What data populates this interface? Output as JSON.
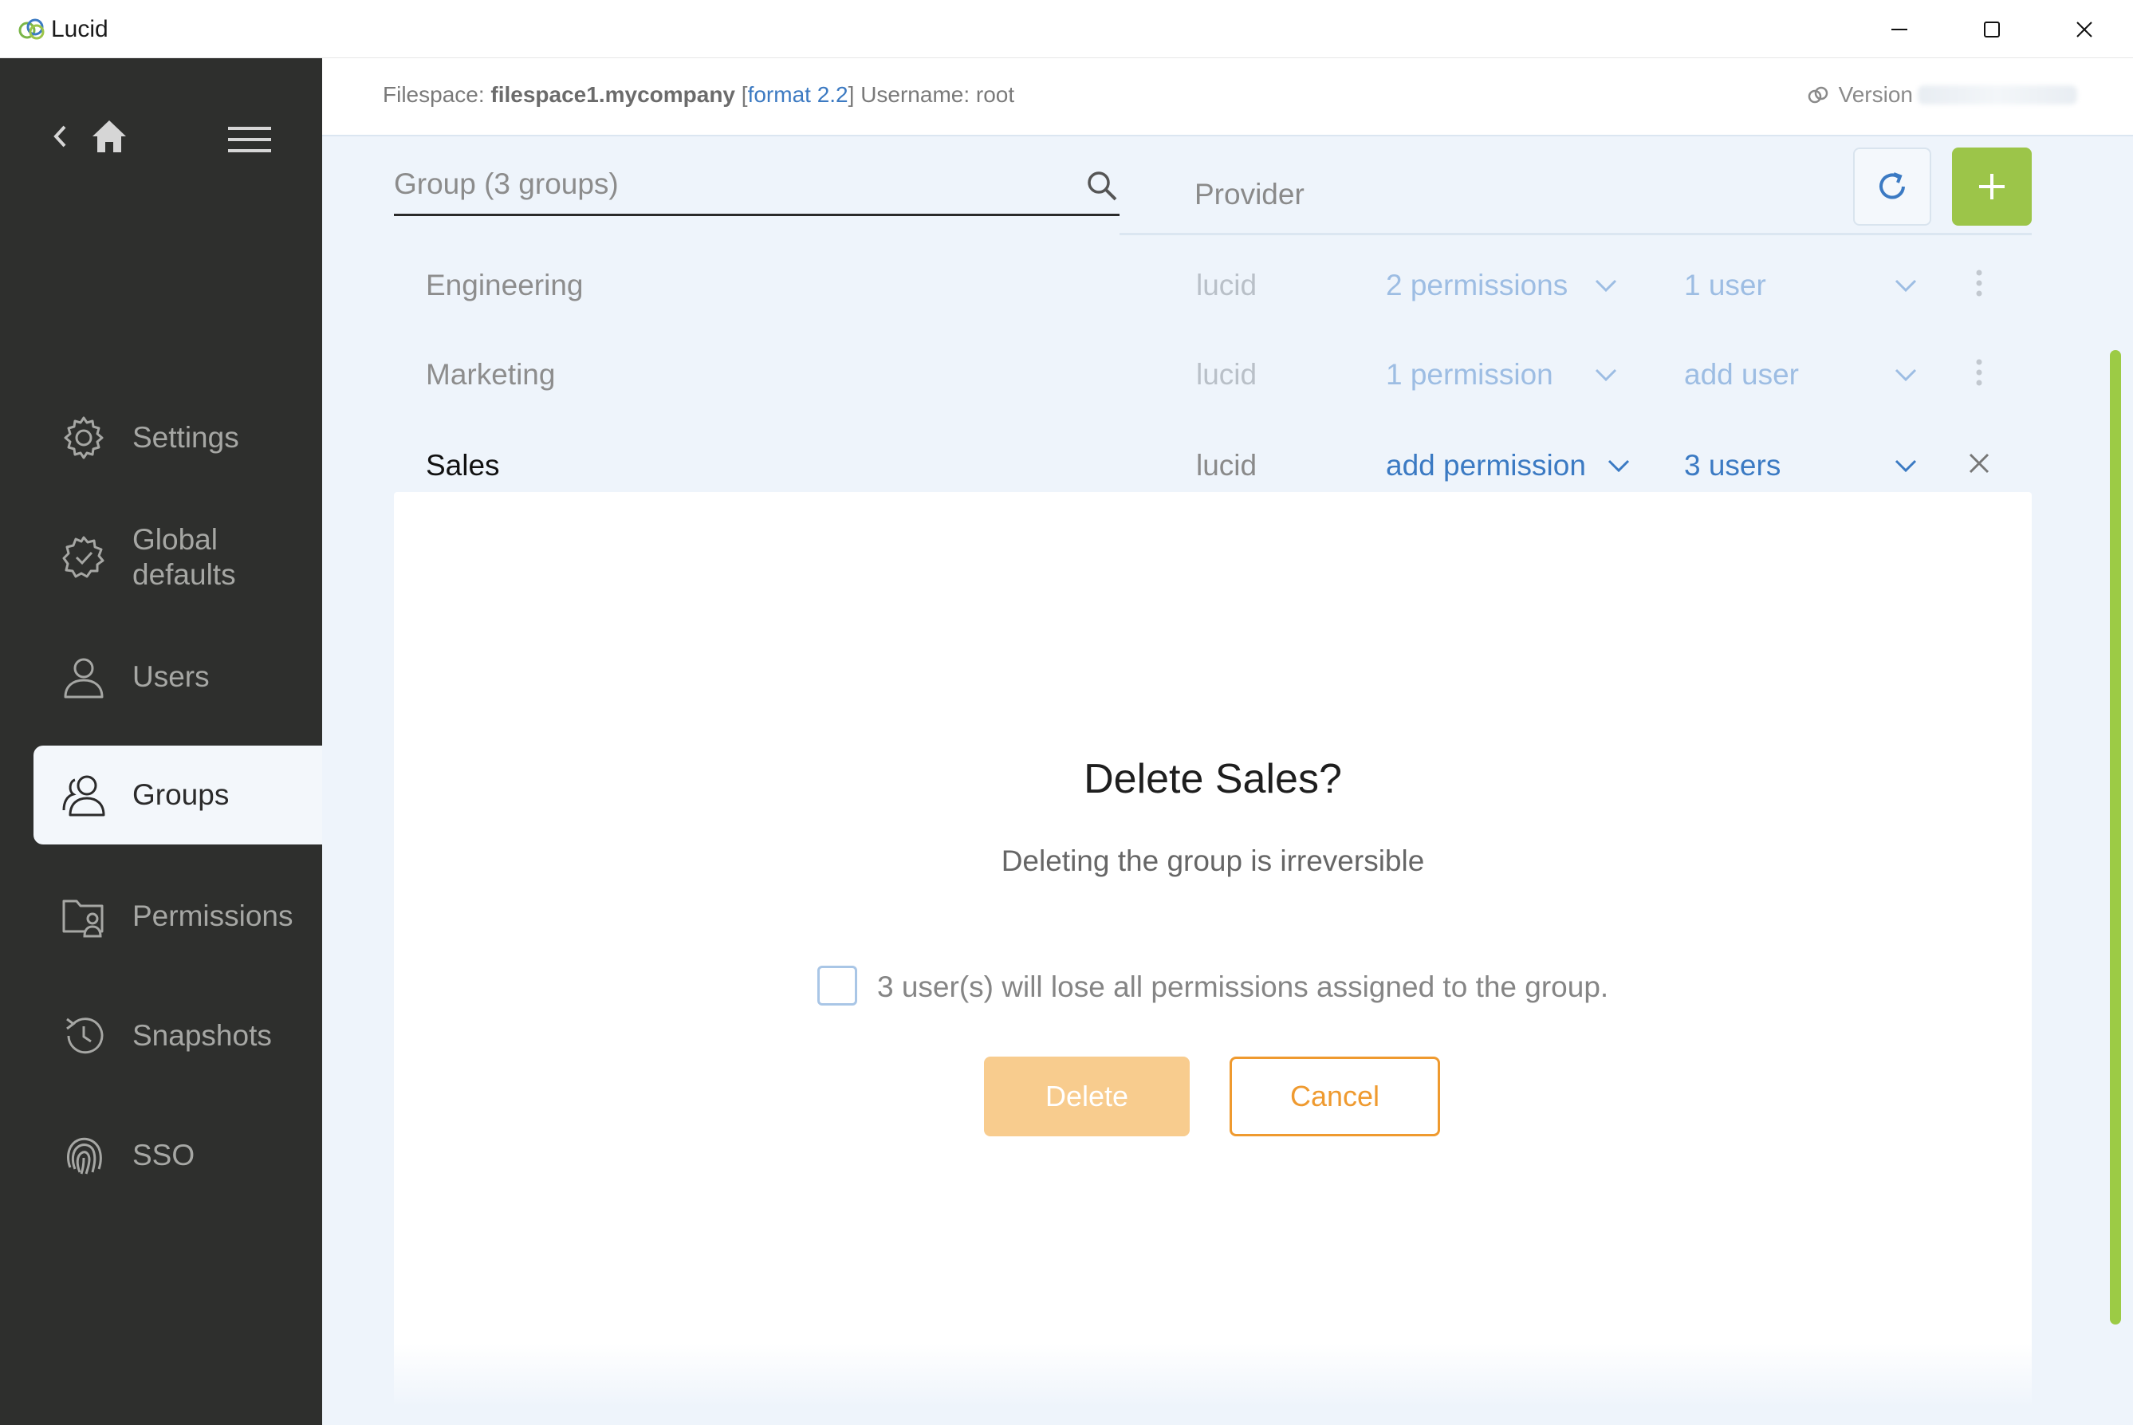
{
  "window": {
    "title": "Lucid",
    "minimize_icon": "minimize-icon",
    "maximize_icon": "maximize-icon",
    "close_icon": "close-icon"
  },
  "topbar": {
    "filespace_label": "Filespace:",
    "filespace_name": "filespace1.mycompany",
    "format_open": "[",
    "format_text": "format 2.2",
    "format_close": "]",
    "username": "Username: root",
    "version_label": "Version"
  },
  "sidebar": {
    "items": [
      {
        "label": "Settings",
        "icon": "gear-icon"
      },
      {
        "label": "Global defaults",
        "icon": "badge-check-icon"
      },
      {
        "label": "Users",
        "icon": "user-icon"
      },
      {
        "label": "Groups",
        "icon": "users-icon",
        "active": true
      },
      {
        "label": "Permissions",
        "icon": "folder-user-icon"
      },
      {
        "label": "Snapshots",
        "icon": "history-icon"
      },
      {
        "label": "SSO",
        "icon": "fingerprint-icon"
      }
    ]
  },
  "table": {
    "search_placeholder": "Group (3 groups)",
    "provider_header": "Provider",
    "rows": [
      {
        "name": "Engineering",
        "provider": "lucid",
        "permissions": "2 permissions",
        "users": "1 user"
      },
      {
        "name": "Marketing",
        "provider": "lucid",
        "permissions": "1 permission",
        "users": "add user"
      },
      {
        "name": "Sales",
        "provider": "lucid",
        "permissions": "add permission",
        "users": "3 users"
      }
    ]
  },
  "dialog": {
    "title": "Delete Sales?",
    "subtitle": "Deleting the group is irreversible",
    "checkbox_label": "3 user(s) will lose all permissions assigned to the group.",
    "checkbox_checked": false,
    "delete_label": "Delete",
    "cancel_label": "Cancel"
  },
  "colors": {
    "sidebar_bg": "#2e2f2d",
    "main_bg": "#eef4fb",
    "accent_green": "#9cc549",
    "link_blue": "#3b7ac3",
    "delete_orange": "#f8cc8e",
    "cancel_orange": "#ef9a2f"
  }
}
